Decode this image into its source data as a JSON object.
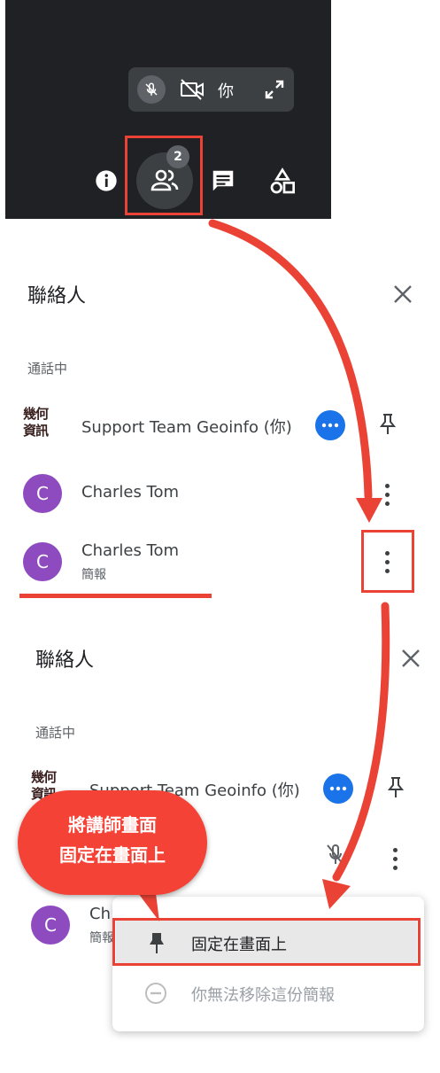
{
  "self_tile": {
    "name": "你"
  },
  "toolbar": {
    "people_count": "2"
  },
  "panel1": {
    "title": "聯絡人",
    "section": "通話中",
    "participants": [
      {
        "name": "Support Team Geoinfo (你)",
        "logo": [
          "幾何",
          "資訊"
        ]
      },
      {
        "name": "Charles Tom",
        "avatar": "C"
      },
      {
        "name": "Charles Tom",
        "avatar": "C",
        "sub": "簡報"
      }
    ]
  },
  "panel2": {
    "title": "聯絡人",
    "section": "通話中",
    "participants": [
      {
        "name": "Support Team Geoinfo (你)",
        "logo": [
          "幾何",
          "資訊"
        ]
      },
      {
        "name": "Ch",
        "avatar": "C",
        "sub": "簡報"
      }
    ]
  },
  "callout": {
    "line1": "將講師畫面",
    "line2": "固定在畫面上"
  },
  "menu": {
    "pin_label": "固定在畫面上",
    "remove_label": "你無法移除這份簡報"
  },
  "colors": {
    "annotation": "#ea4335",
    "accent": "#1a73e8",
    "avatar": "#8e4bc0"
  }
}
